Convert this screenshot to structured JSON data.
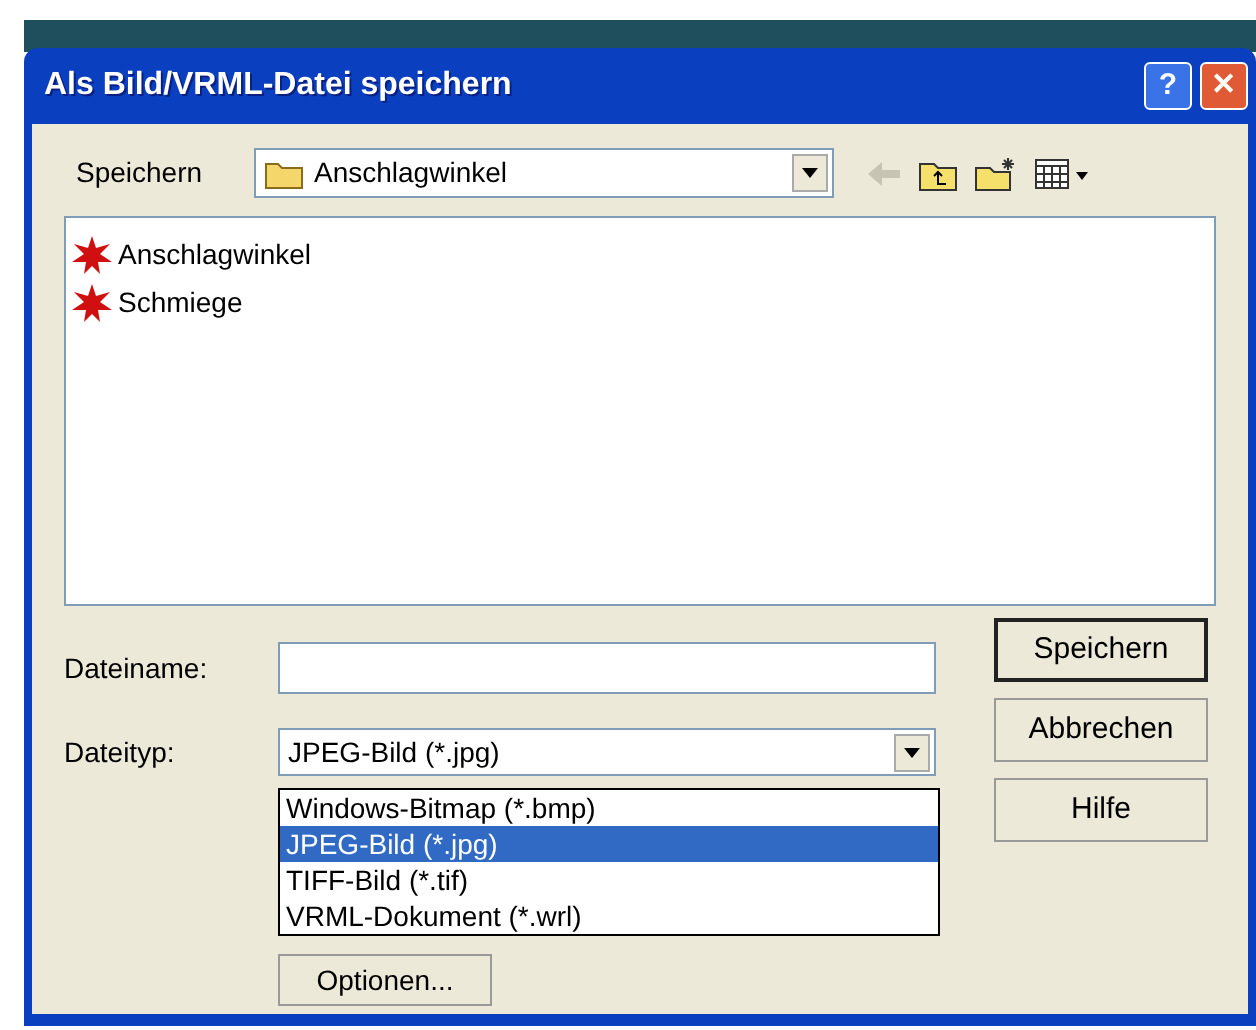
{
  "window": {
    "title": "Als Bild/VRML-Datei speichern",
    "title_buttons": [
      "?",
      "✕"
    ]
  },
  "save_in": {
    "label": "Speichern",
    "value": "Anschlagwinkel"
  },
  "files": [
    {
      "name": "Anschlagwinkel"
    },
    {
      "name": "Schmiege"
    }
  ],
  "file_name": {
    "label": "Dateiname:"
  },
  "file_type": {
    "label": "Dateityp:",
    "value": "JPEG-Bild (*.jpg)",
    "expanded": true,
    "options": [
      {
        "label": "Windows-Bitmap (*.bmp)",
        "selected": false
      },
      {
        "label": "JPEG-Bild (*.jpg)",
        "selected": true
      },
      {
        "label": "TIFF-Bild (*.tif)",
        "selected": false
      },
      {
        "label": "VRML-Dokument (*.wrl)",
        "selected": false
      }
    ]
  },
  "buttons": [
    {
      "label": "Speichern",
      "default": true
    },
    {
      "label": "Abbrechen",
      "default": false
    },
    {
      "label": "Hilfe",
      "default": false
    }
  ],
  "options_button": {
    "label": "Optionen..."
  }
}
